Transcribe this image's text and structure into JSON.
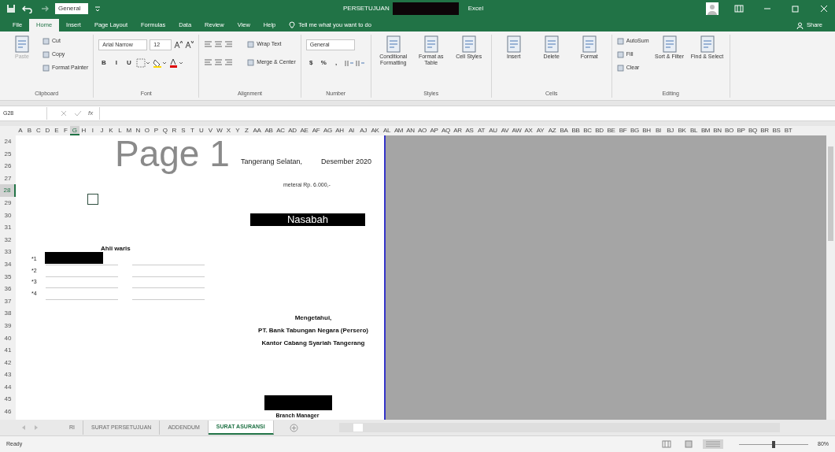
{
  "quick_access": {
    "style_box": "General"
  },
  "window": {
    "title": "PERSETUJUAN",
    "app": "Excel"
  },
  "ribbon_tabs": [
    {
      "label": "File",
      "selected": false
    },
    {
      "label": "Home",
      "selected": true
    },
    {
      "label": "Insert",
      "selected": false
    },
    {
      "label": "Page Layout",
      "selected": false
    },
    {
      "label": "Formulas",
      "selected": false
    },
    {
      "label": "Data",
      "selected": false
    },
    {
      "label": "Review",
      "selected": false
    },
    {
      "label": "View",
      "selected": false
    },
    {
      "label": "Help",
      "selected": false
    }
  ],
  "tell_me": "Tell me what you want to do",
  "share": "Share",
  "ribbon_groups": [
    {
      "name": "Clipboard",
      "commands": [
        {
          "kind": "large",
          "label": "Paste",
          "disabled": true
        },
        {
          "kind": "small",
          "label": "Cut"
        },
        {
          "kind": "small",
          "label": "Copy"
        },
        {
          "kind": "small",
          "label": "Format Painter"
        }
      ]
    },
    {
      "name": "Font",
      "top": [
        {
          "kind": "wide-field",
          "label": "Arial Narrow"
        },
        {
          "kind": "narrow-field",
          "label": "12"
        },
        {
          "kind": "grow"
        },
        {
          "kind": "shrink"
        }
      ],
      "bottom": [
        {
          "kind": "bold",
          "label": "B"
        },
        {
          "kind": "italic",
          "label": "I"
        },
        {
          "kind": "underline",
          "label": "U"
        },
        {
          "kind": "border"
        },
        {
          "kind": "fill"
        },
        {
          "kind": "fontcolor"
        }
      ]
    },
    {
      "name": "Alignment",
      "top": [
        {
          "kind": "align"
        },
        {
          "kind": "small",
          "label": "Wrap Text"
        }
      ],
      "bottom": [
        {
          "kind": "align"
        },
        {
          "kind": "small",
          "label": "Merge & Center"
        }
      ]
    },
    {
      "name": "Number",
      "top": [
        {
          "kind": "wide-field",
          "label": "General"
        }
      ],
      "bottom": [
        {
          "kind": "currency",
          "label": "$"
        },
        {
          "kind": "percent",
          "label": "%"
        },
        {
          "kind": "comma",
          "label": ","
        },
        {
          "kind": "decimal"
        }
      ]
    },
    {
      "name": "Styles",
      "commands": [
        {
          "kind": "large",
          "label": "Conditional Formatting"
        },
        {
          "kind": "large",
          "label": "Format as Table"
        },
        {
          "kind": "large",
          "label": "Cell Styles"
        }
      ]
    },
    {
      "name": "Cells",
      "commands": [
        {
          "kind": "large",
          "label": "Insert"
        },
        {
          "kind": "large",
          "label": "Delete"
        },
        {
          "kind": "large",
          "label": "Format"
        }
      ]
    },
    {
      "name": "Editing",
      "commands": [
        {
          "kind": "small",
          "label": "AutoSum"
        },
        {
          "kind": "small",
          "label": "Fill"
        },
        {
          "kind": "small",
          "label": "Clear"
        },
        {
          "kind": "large",
          "label": "Sort & Filter"
        },
        {
          "kind": "large",
          "label": "Find & Select"
        }
      ]
    }
  ],
  "formula_bar": {
    "name_box": "G28",
    "fx": "fx"
  },
  "columns": [
    {
      "label": "A",
      "selected": false
    },
    {
      "label": "B",
      "selected": false
    },
    {
      "label": "C",
      "selected": false
    },
    {
      "label": "D",
      "selected": false
    },
    {
      "label": "E",
      "selected": false
    },
    {
      "label": "F",
      "selected": false
    },
    {
      "label": "G",
      "selected": true
    },
    {
      "label": "H",
      "selected": false
    },
    {
      "label": "I",
      "selected": false
    },
    {
      "label": "J",
      "selected": false
    },
    {
      "label": "K",
      "selected": false
    },
    {
      "label": "L",
      "selected": false
    },
    {
      "label": "M",
      "selected": false
    },
    {
      "label": "N",
      "selected": false
    },
    {
      "label": "O",
      "selected": false
    },
    {
      "label": "P",
      "selected": false
    },
    {
      "label": "Q",
      "selected": false
    },
    {
      "label": "R",
      "selected": false
    },
    {
      "label": "S",
      "selected": false
    },
    {
      "label": "T",
      "selected": false
    },
    {
      "label": "U",
      "selected": false
    },
    {
      "label": "V",
      "selected": false
    },
    {
      "label": "W",
      "selected": false
    },
    {
      "label": "X",
      "selected": false
    },
    {
      "label": "Y",
      "selected": false
    },
    {
      "label": "Z",
      "selected": false
    },
    {
      "label": "AA",
      "selected": false
    },
    {
      "label": "AB",
      "selected": false
    },
    {
      "label": "AC",
      "selected": false
    },
    {
      "label": "AD",
      "selected": false
    },
    {
      "label": "AE",
      "selected": false
    },
    {
      "label": "AF",
      "selected": false
    },
    {
      "label": "AG",
      "selected": false
    },
    {
      "label": "AH",
      "selected": false
    },
    {
      "label": "AI",
      "selected": false
    },
    {
      "label": "AJ",
      "selected": false
    },
    {
      "label": "AK",
      "selected": false
    },
    {
      "label": "AL",
      "selected": false
    },
    {
      "label": "AM",
      "selected": false
    },
    {
      "label": "AN",
      "selected": false
    },
    {
      "label": "AO",
      "selected": false
    },
    {
      "label": "AP",
      "selected": false
    },
    {
      "label": "AQ",
      "selected": false
    },
    {
      "label": "AR",
      "selected": false
    },
    {
      "label": "AS",
      "selected": false
    },
    {
      "label": "AT",
      "selected": false
    },
    {
      "label": "AU",
      "selected": false
    },
    {
      "label": "AV",
      "selected": false
    },
    {
      "label": "AW",
      "selected": false
    },
    {
      "label": "AX",
      "selected": false
    },
    {
      "label": "AY",
      "selected": false
    },
    {
      "label": "AZ",
      "selected": false
    },
    {
      "label": "BA",
      "selected": false
    },
    {
      "label": "BB",
      "selected": false
    },
    {
      "label": "BC",
      "selected": false
    },
    {
      "label": "BD",
      "selected": false
    },
    {
      "label": "BE",
      "selected": false
    },
    {
      "label": "BF",
      "selected": false
    },
    {
      "label": "BG",
      "selected": false
    },
    {
      "label": "BH",
      "selected": false
    },
    {
      "label": "BI",
      "selected": false
    },
    {
      "label": "BJ",
      "selected": false
    },
    {
      "label": "BK",
      "selected": false
    },
    {
      "label": "BL",
      "selected": false
    },
    {
      "label": "BM",
      "selected": false
    },
    {
      "label": "BN",
      "selected": false
    },
    {
      "label": "BO",
      "selected": false
    },
    {
      "label": "BP",
      "selected": false
    },
    {
      "label": "BQ",
      "selected": false
    },
    {
      "label": "BR",
      "selected": false
    },
    {
      "label": "BS",
      "selected": false
    },
    {
      "label": "BT",
      "selected": false
    }
  ],
  "rows": [
    {
      "label": "24",
      "selected": false
    },
    {
      "label": "25",
      "selected": false
    },
    {
      "label": "26",
      "selected": false
    },
    {
      "label": "27",
      "selected": false
    },
    {
      "label": "28",
      "selected": true
    },
    {
      "label": "29",
      "selected": false
    },
    {
      "label": "30",
      "selected": false
    },
    {
      "label": "31",
      "selected": false
    },
    {
      "label": "32",
      "selected": false
    },
    {
      "label": "33",
      "selected": false
    },
    {
      "label": "34",
      "selected": false
    },
    {
      "label": "35",
      "selected": false
    },
    {
      "label": "36",
      "selected": false
    },
    {
      "label": "37",
      "selected": false
    },
    {
      "label": "38",
      "selected": false
    },
    {
      "label": "39",
      "selected": false
    },
    {
      "label": "40",
      "selected": false
    },
    {
      "label": "41",
      "selected": false
    },
    {
      "label": "42",
      "selected": false
    },
    {
      "label": "43",
      "selected": false
    },
    {
      "label": "44",
      "selected": false
    },
    {
      "label": "45",
      "selected": false
    },
    {
      "label": "46",
      "selected": false
    }
  ],
  "page": {
    "watermark": "Page 1",
    "place": "Tangerang Selatan,",
    "date": "Desember 2020",
    "stamp": "meterai Rp. 6.000,-",
    "signer": "Nasabah",
    "checkbox_checked": false,
    "heirs_title": "Ahli waris",
    "heirs": [
      "*1",
      "*2",
      "*3",
      "*4"
    ],
    "acknowledge": [
      "Mengetahui,",
      "PT. Bank Tabungan Negara (Persero)",
      "Kantor Cabang Syariah Tangerang"
    ],
    "manager": "Branch Manager"
  },
  "sheet_tabs": [
    {
      "label": "RI",
      "selected": false
    },
    {
      "label": "SURAT PERSETUJUAN",
      "selected": false
    },
    {
      "label": "ADDENDUM",
      "selected": false
    },
    {
      "label": "SURAT ASURANSI",
      "selected": true
    }
  ],
  "status_bar": {
    "text": "Ready",
    "zoom": "80%",
    "level": 0.5
  }
}
